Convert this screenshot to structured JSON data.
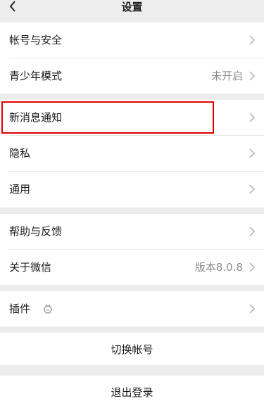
{
  "header": {
    "title": "设置",
    "back_icon": "chevron-left-icon"
  },
  "group1": [
    {
      "label": "帐号与安全",
      "value": ""
    },
    {
      "label": "青少年模式",
      "value": "未开启"
    }
  ],
  "group2": [
    {
      "label": "新消息通知",
      "value": ""
    },
    {
      "label": "隐私",
      "value": ""
    },
    {
      "label": "通用",
      "value": ""
    }
  ],
  "group3": [
    {
      "label": "帮助与反馈",
      "value": ""
    },
    {
      "label": "关于微信",
      "value": "版本8.0.8"
    }
  ],
  "group4": [
    {
      "label": "插件",
      "value": "",
      "icon": "plugin-icon"
    }
  ],
  "actions": {
    "switch_account": "切换帐号",
    "logout": "退出登录"
  },
  "colors": {
    "highlight": "#e00000",
    "background": "#ededed"
  }
}
